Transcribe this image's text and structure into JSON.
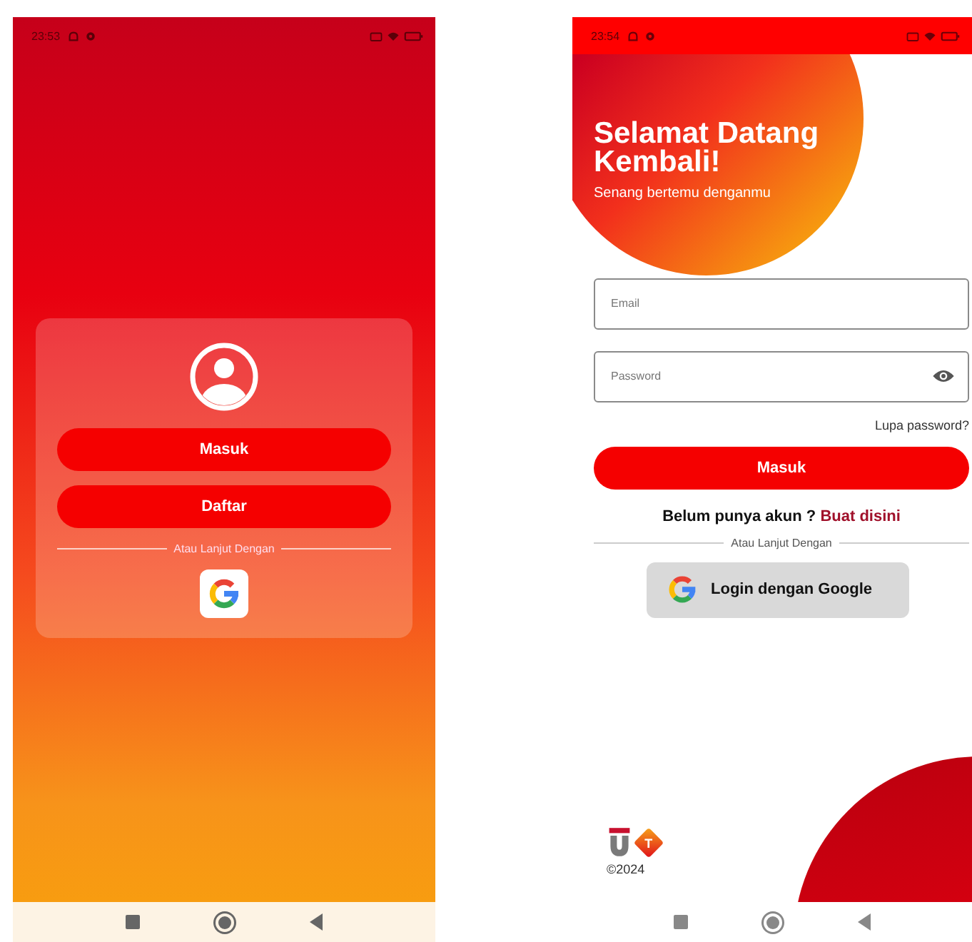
{
  "welcome_screen": {
    "status_bar": {
      "time": "23:53"
    },
    "buttons": [
      {
        "label": "Masuk"
      },
      {
        "label": "Daftar"
      }
    ],
    "divider_text": "Atau Lanjut Dengan"
  },
  "login_screen": {
    "status_bar": {
      "time": "23:54"
    },
    "title": "Selamat Datang Kembali!",
    "subtitle": "Senang bertemu denganmu",
    "fields": [
      {
        "kind": "text",
        "placeholder": "Email"
      },
      {
        "kind": "password",
        "placeholder": "Password"
      }
    ],
    "forgot_link": "Lupa password?",
    "login_button": "Masuk",
    "signup_prompt": {
      "text": "Belum punya akun ?",
      "link": "Buat disini"
    },
    "divider_text": "Atau Lanjut Dengan",
    "google_button": "Login dengan Google",
    "footer": {
      "logo_letter": "T",
      "copyright": "©2024"
    }
  }
}
